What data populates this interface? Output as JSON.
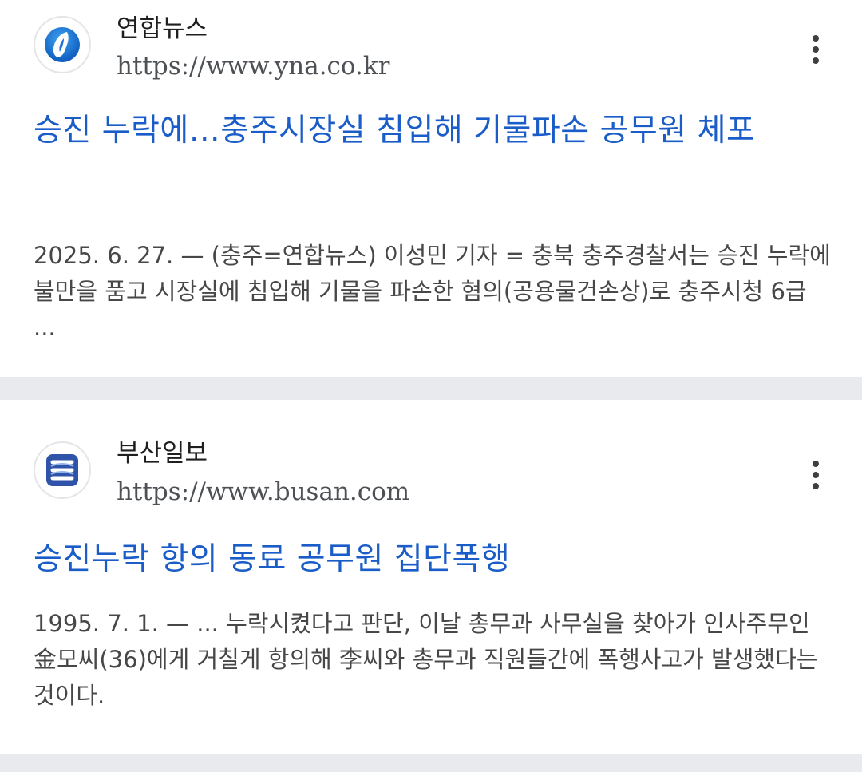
{
  "results": [
    {
      "site_name": "연합뉴스",
      "site_url": "https://www.yna.co.kr",
      "favicon_icon": "yonhap-logo-icon",
      "title": "승진 누락에…충주시장실 침입해 기물파손 공무원 체포",
      "snippet": "2025. 6. 27. — (충주=연합뉴스) 이성민 기자 = 충북 충주경찰서는 승진 누락에 불만을 품고 시장실에 침입해 기물을 파손한 혐의(공용물건손상)로 충주시청 6급 ..."
    },
    {
      "site_name": "부산일보",
      "site_url": "https://www.busan.com",
      "favicon_icon": "busan-ilbo-logo-icon",
      "title": "승진누락 항의 동료 공무원 집단폭행",
      "snippet": "1995. 7. 1. — ... 누락시켰다고 판단, 이날 총무과 사무실을 찾아가 인사주무인 金모씨(36)에게 거칠게 항의해 李씨와 총무과 직원들간에 폭행사고가 발생했다는 것이다."
    }
  ],
  "colors": {
    "link_blue": "#1a5dc8",
    "separator": "#e9eaee"
  }
}
